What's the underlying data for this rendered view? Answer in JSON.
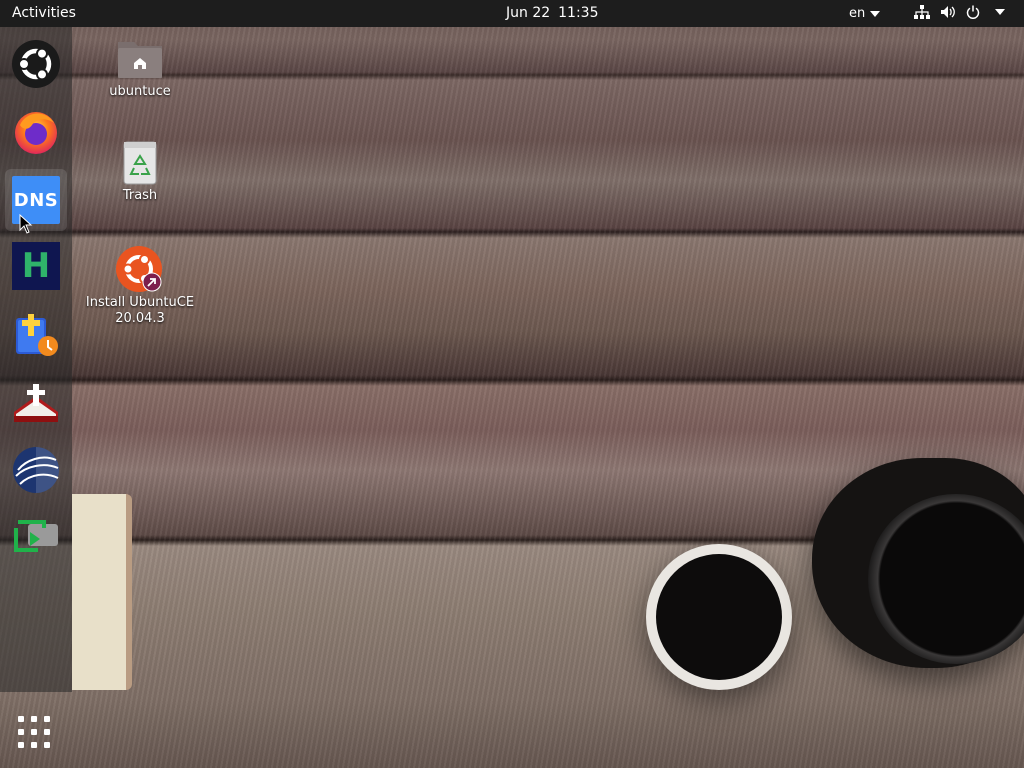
{
  "topbar": {
    "activities": "Activities",
    "date": "Jun 22",
    "time": "11:35",
    "language": "en"
  },
  "dock": {
    "items": [
      {
        "name": "ubuntu-icon"
      },
      {
        "name": "firefox-icon"
      },
      {
        "name": "dns-icon",
        "label": "DNS"
      },
      {
        "name": "h-app-icon",
        "label": "H"
      },
      {
        "name": "bible-app-icon"
      },
      {
        "name": "bible-book-icon"
      },
      {
        "name": "globe-app-icon"
      },
      {
        "name": "screen-recorder-icon"
      }
    ]
  },
  "desktop": {
    "icons": [
      {
        "label": "ubuntuce"
      },
      {
        "label": "Trash"
      },
      {
        "label_line1": "Install UbuntuCE",
        "label_line2": "20.04.3"
      }
    ]
  },
  "colors": {
    "topbar": "#1d1d1d",
    "dns_tile": "#3e8ef7",
    "h_tile": "#0f1650",
    "h_letter": "#2fb36a",
    "ubuntu_orange": "#e95420"
  }
}
